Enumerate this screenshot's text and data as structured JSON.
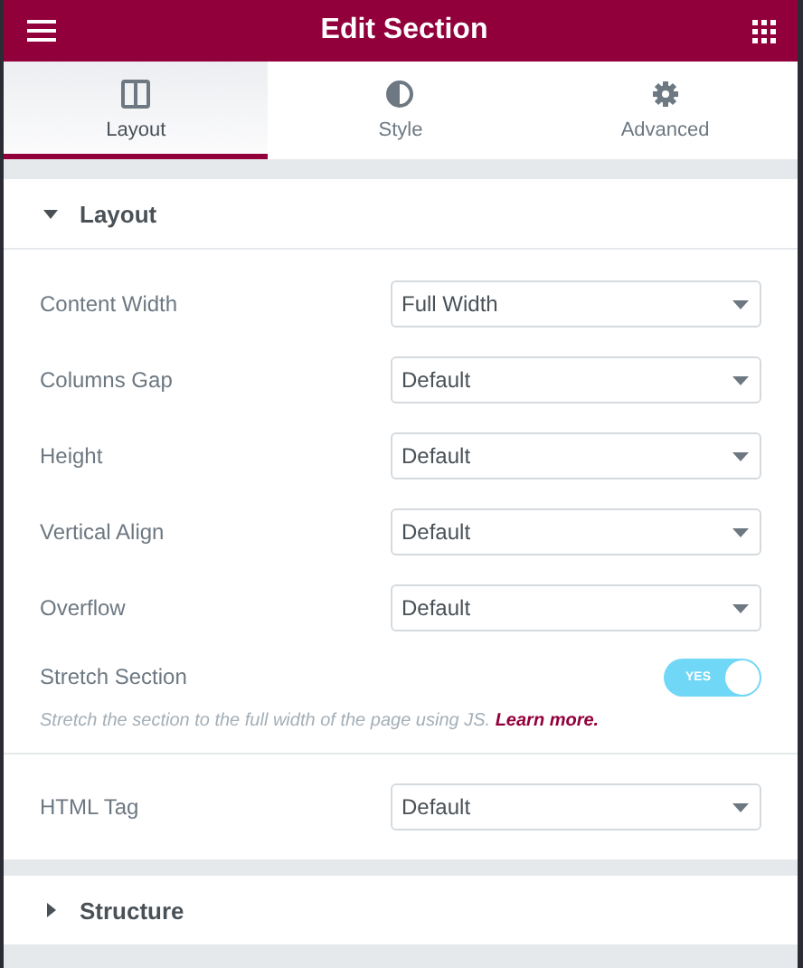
{
  "header": {
    "title": "Edit Section"
  },
  "tabs": [
    {
      "label": "Layout",
      "selected": true
    },
    {
      "label": "Style",
      "selected": false
    },
    {
      "label": "Advanced",
      "selected": false
    }
  ],
  "sections": [
    {
      "title": "Layout",
      "expanded": true,
      "groups": [
        {
          "controls": [
            {
              "kind": "select",
              "label": "Content Width",
              "value": "Full Width"
            },
            {
              "kind": "select",
              "label": "Columns Gap",
              "value": "Default"
            },
            {
              "kind": "select",
              "label": "Height",
              "value": "Default"
            },
            {
              "kind": "select",
              "label": "Vertical Align",
              "value": "Default"
            },
            {
              "kind": "select",
              "label": "Overflow",
              "value": "Default"
            },
            {
              "kind": "switch",
              "label": "Stretch Section",
              "on": true,
              "state_label": "YES",
              "description": "Stretch the section to the full width of the page using JS.",
              "link": "Learn more."
            }
          ]
        },
        {
          "controls": [
            {
              "kind": "select",
              "label": "HTML Tag",
              "value": "Default"
            }
          ]
        }
      ]
    },
    {
      "title": "Structure",
      "expanded": false
    }
  ]
}
